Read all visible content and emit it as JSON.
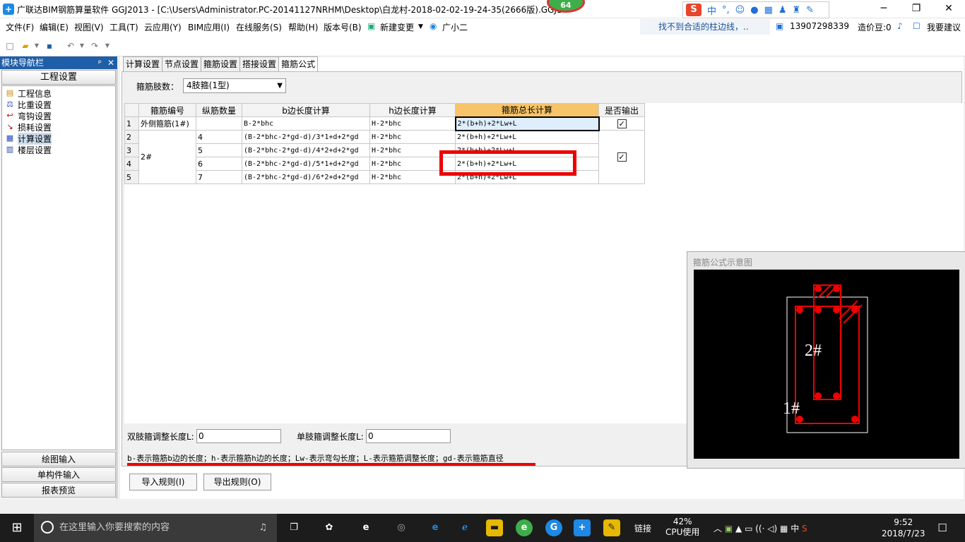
{
  "window": {
    "title": "广联达BIM钢筋算量软件 GGJ2013 - [C:\\Users\\Administrator.PC-20141127NRHM\\Desktop\\白龙村-2018-02-02-19-24-35(2666版).GGJ12",
    "badge": "64",
    "ime": {
      "zh": "中",
      "punct": "°,",
      "logo": "S"
    },
    "min": "─",
    "restore": "❐",
    "close": "✕"
  },
  "menu": {
    "items": [
      "文件(F)",
      "编辑(E)",
      "视图(V)",
      "工具(T)",
      "云应用(Y)",
      "BIM应用(I)",
      "在线服务(S)",
      "帮助(H)",
      "版本号(B)",
      "新建变更",
      "广小二"
    ],
    "tip": "找不到合适的柱边线，..",
    "phone": "13907298339",
    "bean": "造价豆:0",
    "suggest": "我要建议"
  },
  "nav": {
    "header": "模块导航栏",
    "pin": "ᵖ",
    "close": "✕",
    "project": "工程设置",
    "tree": [
      {
        "label": "工程信息",
        "icon": "info-icon"
      },
      {
        "label": "比重设置",
        "icon": "weight-icon"
      },
      {
        "label": "弯钩设置",
        "icon": "hook-icon"
      },
      {
        "label": "损耗设置",
        "icon": "loss-icon"
      },
      {
        "label": "计算设置",
        "icon": "calc-icon"
      },
      {
        "label": "楼层设置",
        "icon": "floor-icon"
      }
    ],
    "bottom": [
      "绘图输入",
      "单构件输入",
      "报表预览"
    ]
  },
  "tabs": [
    "计算设置",
    "节点设置",
    "箍筋设置",
    "搭接设置",
    "箍筋公式"
  ],
  "limbs": {
    "label": "箍筋肢数：",
    "value": "4肢箍(1型)"
  },
  "table": {
    "headers": [
      "箍筋编号",
      "纵筋数量",
      "b边长度计算",
      "h边长度计算",
      "箍筋总长计算",
      "是否输出"
    ],
    "rows": [
      {
        "n": "1",
        "code": "外侧箍筋(1#)",
        "qty": "",
        "b": "B-2*bhc",
        "h": "H-2*bhc",
        "total": "2*(b+h)+2*Lw+L"
      },
      {
        "n": "2",
        "code": "",
        "qty": "4",
        "b": "(B-2*bhc-2*gd-d)/3*1+d+2*gd",
        "h": "H-2*bhc",
        "total": "2*(b+h)+2*Lw+L"
      },
      {
        "n": "3",
        "code": "2#",
        "qty": "5",
        "b": "(B-2*bhc-2*gd-d)/4*2+d+2*gd",
        "h": "H-2*bhc",
        "total": "2*(b+h)+2*Lw+L"
      },
      {
        "n": "4",
        "code": "",
        "qty": "6",
        "b": "(B-2*bhc-2*gd-d)/5*1+d+2*gd",
        "h": "H-2*bhc",
        "total": "2*(b+h)+2*Lw+L"
      },
      {
        "n": "5",
        "code": "",
        "qty": "7",
        "b": "(B-2*bhc-2*gd-d)/6*2+d+2*gd",
        "h": "H-2*bhc",
        "total": "2*(b+h)+2*Lw+L"
      }
    ]
  },
  "preview": {
    "title": "箍筋公式示意图",
    "label_2": "2#",
    "label_1": "1#"
  },
  "bottom": {
    "double_label": "双肢箍调整长度L:",
    "double_value": "0",
    "single_label": "单肢箍调整长度L:",
    "single_value": "0",
    "note": "b-表示箍筋b边的长度；h-表示箍筋h边的长度；Lw-表示弯勾长度；L-表示箍筋调整长度；gd-表示箍筋直径",
    "import": "导入规则(I)",
    "export": "导出规则(O)"
  },
  "taskbar": {
    "search_placeholder": "在这里输入你要搜索的内容",
    "link": "链接",
    "cpu_pct": "42%",
    "cpu_label": "CPU使用",
    "ime": "中",
    "time": "9:52",
    "date": "2018/7/23"
  },
  "colors": {
    "accent": "#1f5fa8",
    "annotation": "#e00000",
    "header_highlight": "#f7c469"
  }
}
